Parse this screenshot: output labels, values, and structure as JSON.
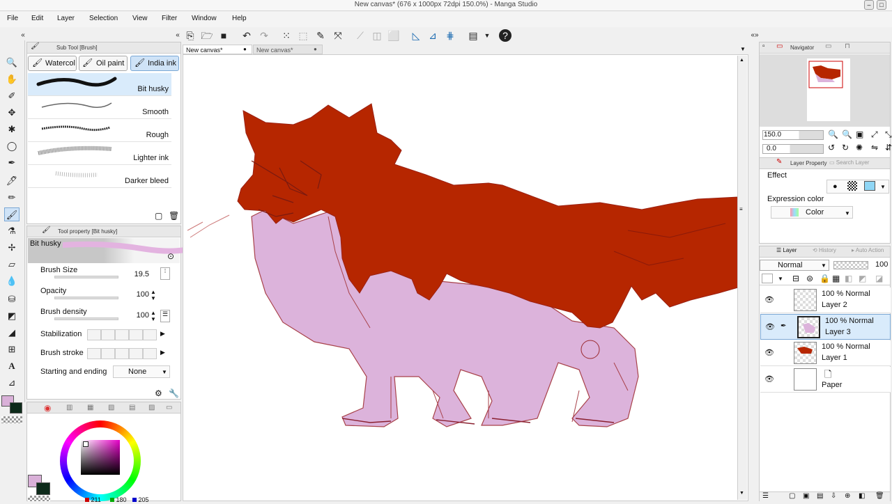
{
  "window": {
    "title": "New canvas* (676 x 1000px 72dpi 150.0%) - Manga Studio"
  },
  "menu": [
    "File",
    "Edit",
    "Layer",
    "Selection",
    "View",
    "Filter",
    "Window",
    "Help"
  ],
  "subtool": {
    "header": "Sub Tool [Brush]",
    "tabs": [
      "Watercol",
      "Oil paint",
      "India ink"
    ],
    "brushes": [
      "Bit husky",
      "Smooth",
      "Rough",
      "Lighter ink",
      "Darker bleed"
    ]
  },
  "tool_property": {
    "header": "Tool property [Bit husky]",
    "brush_name": "Bit husky",
    "brush_size_label": "Brush Size",
    "brush_size": "19.5",
    "opacity_label": "Opacity",
    "opacity": "100",
    "density_label": "Brush density",
    "density": "100",
    "stabilization_label": "Stabilization",
    "stroke_label": "Brush stroke",
    "start_end_label": "Starting and ending",
    "start_end_value": "None"
  },
  "color": {
    "main": "#d9b0d8",
    "sub": "#0d2a1a",
    "r": "211",
    "g": "180",
    "b": "205"
  },
  "documents": [
    "New canvas*",
    "New canvas*"
  ],
  "navigator": {
    "title": "Navigator",
    "zoom": "150.0",
    "angle": "0.0"
  },
  "layer_property": {
    "title": "Layer Property",
    "search": "Search Layer",
    "effect_label": "Effect",
    "expression_label": "Expression color",
    "expression_value": "Color"
  },
  "layer_panel": {
    "tabs": [
      "Layer",
      "History",
      "Auto Action"
    ],
    "blend_mode": "Normal",
    "opacity": "100",
    "layers": [
      {
        "pct": "100 %",
        "mode": "Normal",
        "name": "Layer 2"
      },
      {
        "pct": "100 %",
        "mode": "Normal",
        "name": "Layer 3"
      },
      {
        "pct": "100 %",
        "mode": "Normal",
        "name": "Layer 1"
      },
      {
        "name": "Paper"
      }
    ]
  }
}
